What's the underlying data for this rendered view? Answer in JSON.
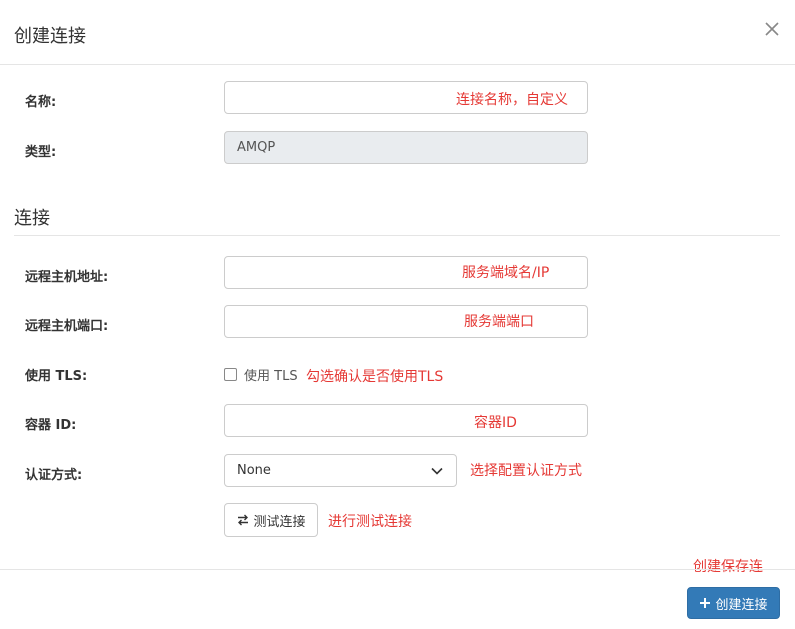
{
  "modal": {
    "title": "创建连接"
  },
  "fields": {
    "name": {
      "label": "名称:",
      "hint": "连接名称，自定义"
    },
    "type": {
      "label": "类型:",
      "value": "AMQP"
    }
  },
  "connection_section": {
    "title": "连接"
  },
  "connection": {
    "host": {
      "label": "远程主机地址:",
      "hint": "服务端域名/IP"
    },
    "port": {
      "label": "远程主机端口:",
      "hint": "服务端端口"
    },
    "tls": {
      "label": "使用 TLS:",
      "checkbox_label": "使用 TLS",
      "hint": "勾选确认是否使用TLS"
    },
    "container": {
      "label": "容器 ID:",
      "hint": "容器ID"
    },
    "auth": {
      "label": "认证方式:",
      "value": "None",
      "hint": "选择配置认证方式"
    },
    "test": {
      "button_label": "测试连接",
      "hint": "进行测试连接"
    }
  },
  "footer": {
    "hint": "创建保存连",
    "create_label": "创建连接"
  },
  "colors": {
    "primary": "#337ab7",
    "hint": "#e53935",
    "readonly_bg": "#e9ecef"
  }
}
